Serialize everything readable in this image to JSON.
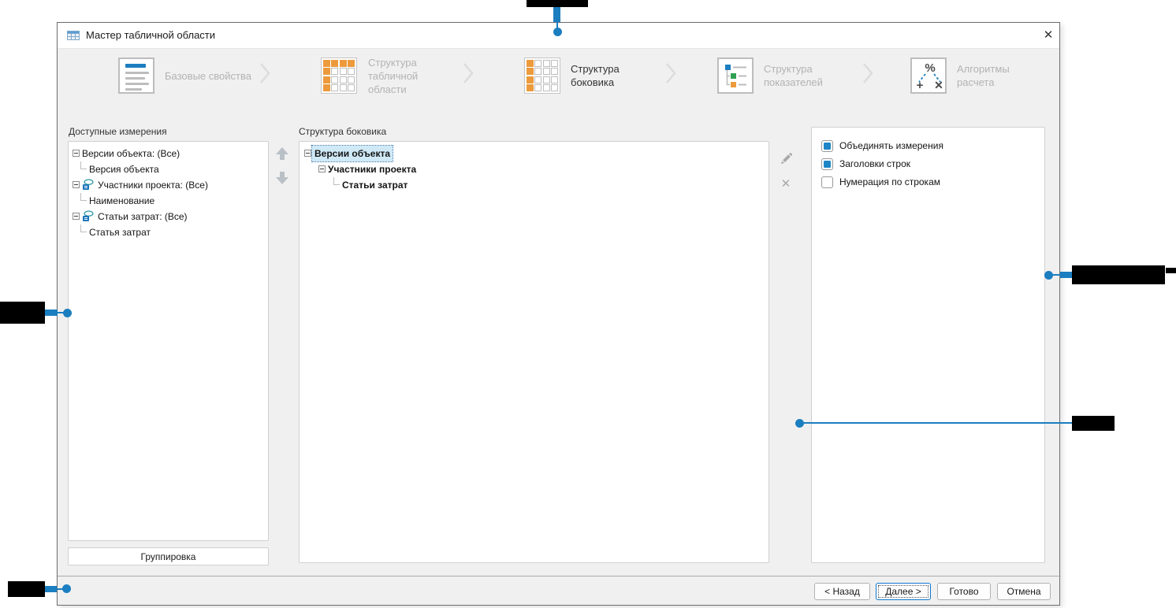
{
  "window": {
    "title": "Мастер табличной области",
    "title_icon": "table-grid-icon",
    "close_glyph": "✕"
  },
  "wizard_steps": [
    {
      "label": "Базовые свойства",
      "icon": "document-properties-icon",
      "active": false
    },
    {
      "label": "Структура табличной области",
      "icon": "table-header-row-column-icon",
      "active": false
    },
    {
      "label": "Структура боковика",
      "icon": "table-side-column-icon",
      "active": true
    },
    {
      "label": "Структура показателей",
      "icon": "hierarchy-list-icon",
      "active": false
    },
    {
      "label": "Алгоритмы расчета",
      "icon": "percent-plus-multiply-icon",
      "active": false
    }
  ],
  "available_dimensions": {
    "title": "Доступные измерения",
    "tree": [
      {
        "label": "Версии объекта: (Все)",
        "level": 0,
        "expander": true,
        "icon": null
      },
      {
        "label": "Версия объекта",
        "level": 1
      },
      {
        "label": "Участники проекта: (Все)",
        "level": 0,
        "expander": true,
        "icon": "linked-dimension-icon"
      },
      {
        "label": "Наименование",
        "level": 1
      },
      {
        "label": "Статьи затрат: (Все)",
        "level": 0,
        "expander": true,
        "icon": "linked-dimension-icon"
      },
      {
        "label": "Статья затрат",
        "level": 1
      }
    ],
    "grouping_button": "Группировка"
  },
  "sidebar_structure": {
    "title": "Структура боковика",
    "tree": [
      {
        "label": "Версии объекта",
        "level": 0,
        "selected": true
      },
      {
        "label": "Участники проекта",
        "level": 1,
        "selected": false
      },
      {
        "label": "Статьи затрат",
        "level": 2,
        "selected": false
      }
    ],
    "actions": [
      "edit-pencil-icon",
      "delete-x-icon"
    ],
    "reorder": [
      "move-up-icon",
      "move-down-icon"
    ]
  },
  "options": {
    "checkboxes": [
      {
        "label": "Объединять измерения",
        "checked": true
      },
      {
        "label": "Заголовки строк",
        "checked": true
      },
      {
        "label": "Нумерация по строкам",
        "checked": false
      }
    ]
  },
  "footer_buttons": {
    "back": "< Назад",
    "next": "Далее >",
    "finish": "Готово",
    "cancel": "Отмена"
  },
  "colors": {
    "accent_blue": "#1b7ec0",
    "accent_orange": "#ec9a3c",
    "accent_green": "#2fa052",
    "checkbox_blue": "#1e86c7",
    "selection_bg": "#cfe9f7",
    "dialog_bg": "#f0f0f0",
    "inactive_step_text": "#b3b3b3"
  }
}
